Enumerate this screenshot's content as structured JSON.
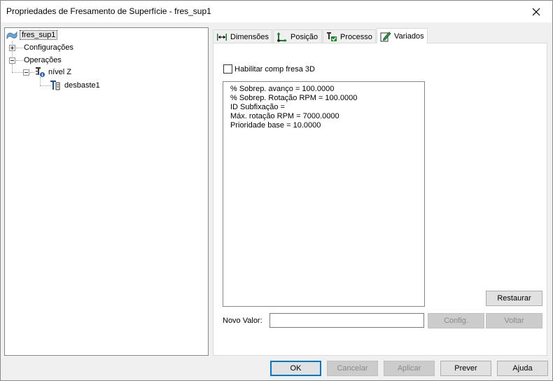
{
  "window": {
    "title": "Propriedades de Fresamento de Superfície - fres_sup1",
    "close_symbol": "✕"
  },
  "tree": {
    "root": {
      "label": "fres_sup1",
      "icon": "surface-icon"
    },
    "configuracoes": {
      "label": "Configurações",
      "expander": "plus"
    },
    "operacoes": {
      "label": "Operações",
      "expander": "minus"
    },
    "nivel_z": {
      "label": "nível Z",
      "expander": "minus",
      "icon": "level-z-icon"
    },
    "desbaste": {
      "label": "desbaste1",
      "icon": "tool-icon"
    }
  },
  "tabs": [
    {
      "label": "Dimensões",
      "icon": "dimension-icon"
    },
    {
      "label": "Posição",
      "icon": "position-icon"
    },
    {
      "label": "Processo",
      "icon": "process-icon"
    },
    {
      "label": "Variados",
      "icon": "edit-icon",
      "active": true
    }
  ],
  "variados": {
    "checkbox_label": "Habilitar comp fresa 3D",
    "checkbox_checked": false,
    "list_lines": [
      "% Sobrep. avanço = 100.0000",
      "% Sobrep. Rotação RPM = 100.0000",
      "ID Subfixação =",
      "Máx. rotação RPM = 7000.0000",
      "Prioridade base = 10.0000"
    ],
    "restaurar_label": "Restaurar",
    "novo_valor_label": "Novo Valor:",
    "novo_valor_value": "",
    "config_label": "Config.",
    "voltar_label": "Voltar"
  },
  "footer": {
    "ok_label": "OK",
    "cancelar_label": "Cancelar",
    "aplicar_label": "Aplicar",
    "prever_label": "Prever",
    "ajuda_label": "Ajuda"
  }
}
